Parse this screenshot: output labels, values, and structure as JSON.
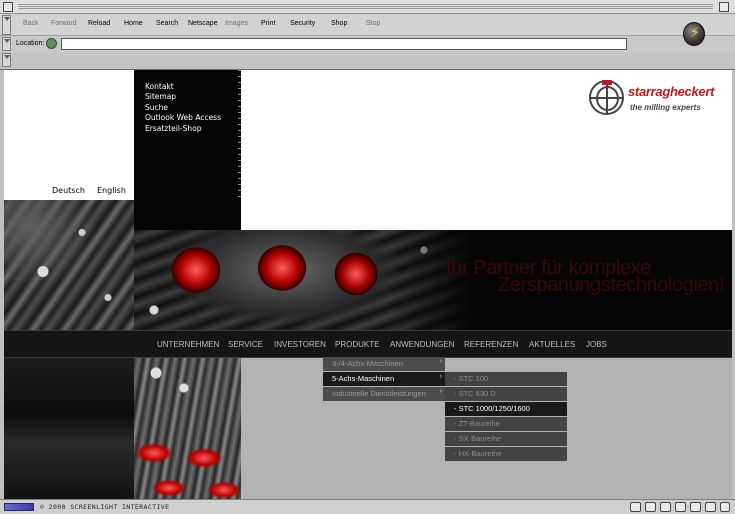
{
  "browser": {
    "nav_buttons": {
      "back": "Back",
      "forward": "Forward",
      "reload": "Reload",
      "home": "Home",
      "search": "Search",
      "netscape": "Netscape",
      "images": "Images",
      "print": "Print",
      "security": "Security",
      "shop": "Shop",
      "stop": "Stop"
    },
    "location_label": "Location:",
    "location_value": "",
    "throbber_icon": "netscape-lightning-icon",
    "status_text": "© 2000 SCREENLIGHT INTERACTIVE"
  },
  "site": {
    "top_links": [
      "Kontakt",
      "Sitemap",
      "Suche",
      "Outlook Web Access",
      "Ersatzteil-Shop"
    ],
    "languages": [
      "Deutsch",
      "English"
    ],
    "logo": {
      "name": "starragheckert",
      "tagline": "the milling experts"
    },
    "slogan_line1": "Ihr Partner für komplexe",
    "slogan_line2": "Zerspanungstechnologien!",
    "menu": [
      "UNTERNEHMEN",
      "SERVICE",
      "INVESTOREN",
      "PRODUKTE",
      "ANWENDUNGEN",
      "REFERENZEN",
      "AKTUELLES",
      "JOBS"
    ],
    "submenu1": [
      "3-/4-Achs-Maschinen",
      "5-Achs-Maschinen",
      "Industrielle Dienstleistungen"
    ],
    "submenu1_active": "5-Achs-Maschinen",
    "submenu2": [
      "- STC 100",
      "- STC 630 D",
      "- STC 1000/1250/1600",
      "- ZT-Baureihe",
      "- SX-Baureihe",
      "- HX-Baureihe"
    ],
    "submenu2_active": "- STC 1000/1250/1600",
    "arrow_glyph": "›"
  },
  "colors": {
    "brand_red": "#c21a1a",
    "menu_bg": "#151515",
    "page_grey": "#b3b3b3"
  }
}
